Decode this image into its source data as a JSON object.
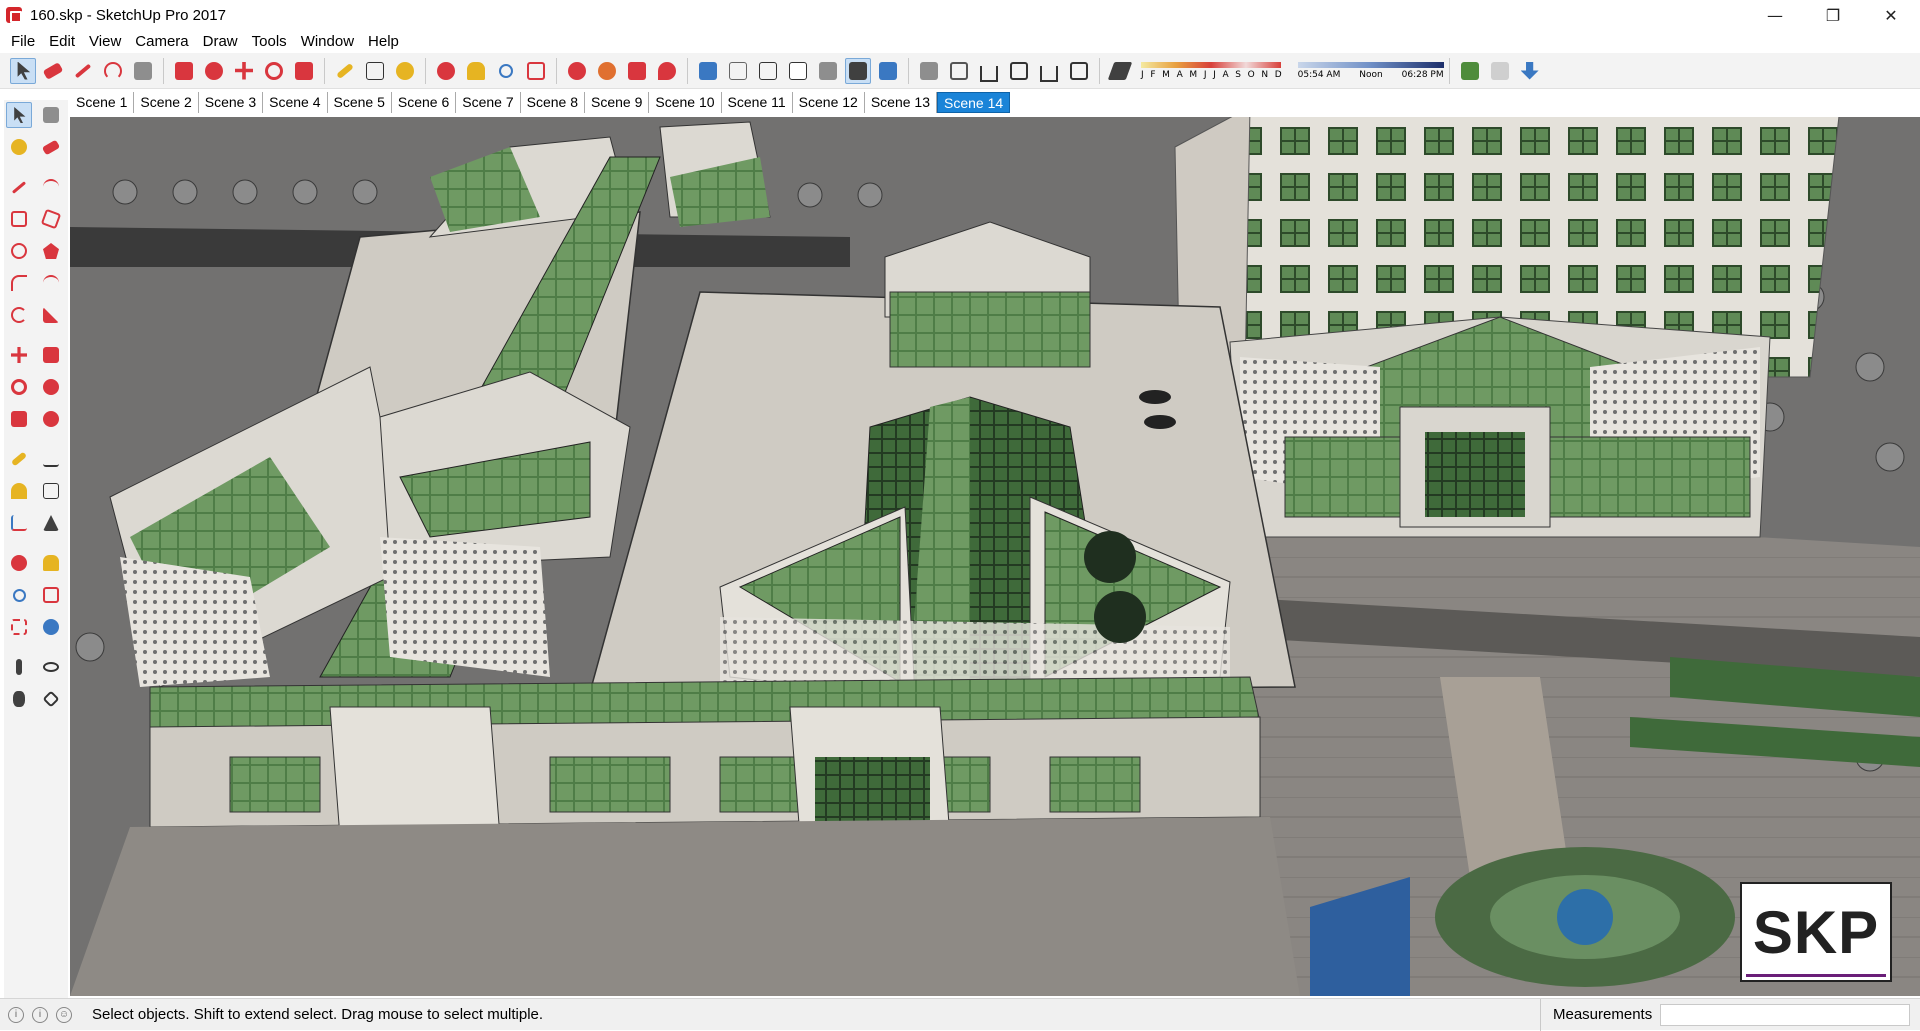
{
  "window": {
    "title": "160.skp - SketchUp Pro 2017",
    "minimize": "—",
    "maximize": "❐",
    "close": "✕"
  },
  "menu": [
    "File",
    "Edit",
    "View",
    "Camera",
    "Draw",
    "Tools",
    "Window",
    "Help"
  ],
  "toolbar": {
    "months": "J F M A M J J A S O N D",
    "time_start": "05:54 AM",
    "time_mid": "Noon",
    "time_end": "06:28 PM"
  },
  "scenes": [
    "Scene 1",
    "Scene 2",
    "Scene 3",
    "Scene 4",
    "Scene 5",
    "Scene 6",
    "Scene 7",
    "Scene 8",
    "Scene 9",
    "Scene 10",
    "Scene 11",
    "Scene 12",
    "Scene 13",
    "Scene 14"
  ],
  "active_scene": "Scene 14",
  "viewport": {
    "logo_text": "SKP"
  },
  "status": {
    "message": "Select objects. Shift to extend select. Drag mouse to select multiple.",
    "measurements_label": "Measurements",
    "measurements_value": ""
  },
  "colors": {
    "accent": "#1a84d8",
    "glass": "#4e7a45",
    "stone": "#d9d6cf",
    "ground": "#6f6f6f"
  }
}
